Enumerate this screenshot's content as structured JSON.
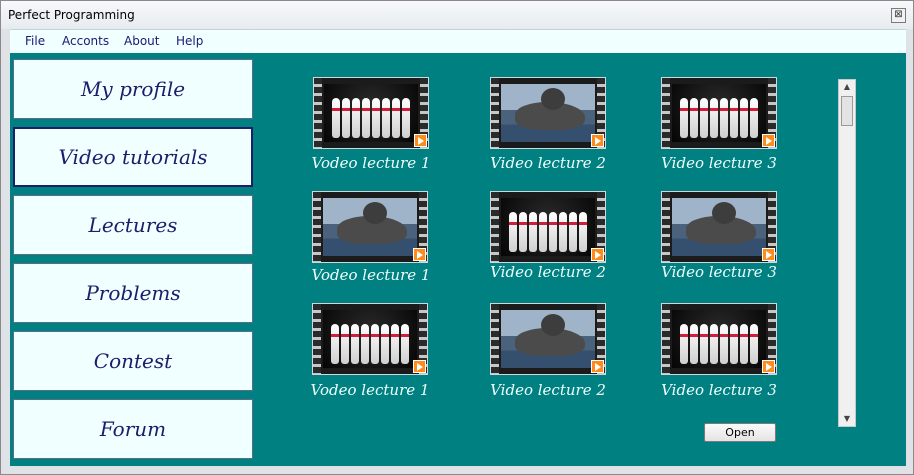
{
  "window": {
    "title": "Perfect Programming",
    "close_glyph": "⊠"
  },
  "menu": [
    "File",
    "Acconts",
    "About",
    "Help"
  ],
  "nav": {
    "items": [
      "My profile",
      "Video tutorials",
      "Lectures",
      "Problems",
      "Contest",
      "Forum"
    ],
    "active_index": 1
  },
  "videos": [
    {
      "caption": "Vodeo lecture 1",
      "thumbnail": "bowling-pins"
    },
    {
      "caption": "Video lecture 2",
      "thumbnail": "seal"
    },
    {
      "caption": "Video lecture 3",
      "thumbnail": "bowling-pins"
    },
    {
      "caption": "Vodeo lecture 1",
      "thumbnail": "seal"
    },
    {
      "caption": "Video lecture 2",
      "thumbnail": "bowling-pins"
    },
    {
      "caption": "Video lecture 3",
      "thumbnail": "seal"
    },
    {
      "caption": "Vodeo lecture 1",
      "thumbnail": "bowling-pins"
    },
    {
      "caption": "Video lecture 2",
      "thumbnail": "seal"
    },
    {
      "caption": "Video lecture 3",
      "thumbnail": "bowling-pins"
    }
  ],
  "scroll": {
    "up_glyph": "▲",
    "down_glyph": "▼"
  },
  "open_button": "Open",
  "colors": {
    "content_bg": "#008080",
    "nav_text": "#1d1d6b",
    "play_badge": "#ff8c1a"
  }
}
